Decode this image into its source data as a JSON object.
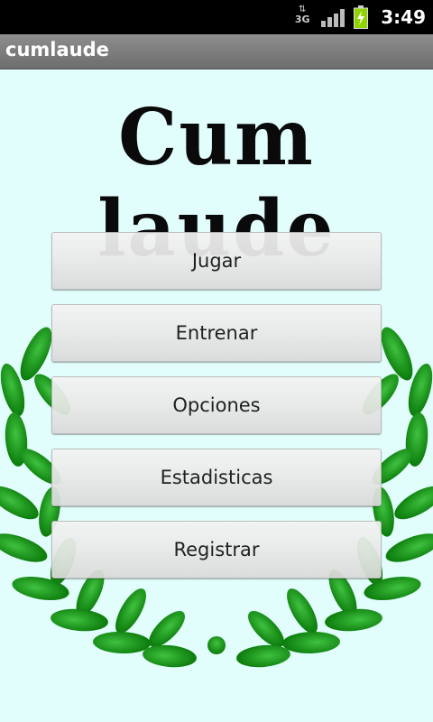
{
  "status_bar": {
    "network": "3G",
    "time": "3:49",
    "icons": [
      "data-activity-icon",
      "signal-icon",
      "battery-charging-icon"
    ]
  },
  "app": {
    "title": "cumlaude"
  },
  "main": {
    "logo_text": "Cum laude",
    "buttons": [
      {
        "label": "Jugar"
      },
      {
        "label": "Entrenar"
      },
      {
        "label": "Opciones"
      },
      {
        "label": "Estadisticas"
      },
      {
        "label": "Registrar"
      }
    ]
  },
  "colors": {
    "background": "#e1fefc",
    "leaf": "#1f9a1f",
    "title_bar": "#7a7a7a"
  }
}
